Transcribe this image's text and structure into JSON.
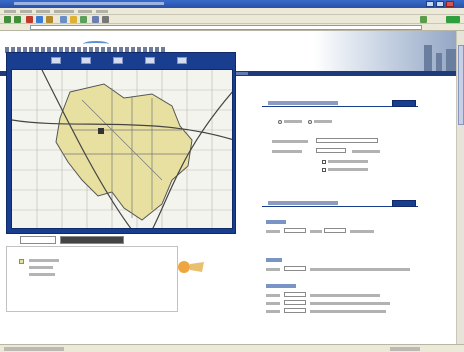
{
  "window": {
    "title": ""
  },
  "colors": {
    "titlebar": "#2851a8",
    "site_nav": "#1e3a7a",
    "map_frame": "#1a3e8f",
    "map_highlight": "#e8e0a0",
    "button_blue": "#1a3e8f",
    "go_green": "#2f9e3c"
  },
  "icons": {
    "window_controls": [
      "minimize-icon",
      "maximize-icon",
      "close-icon"
    ],
    "toolbar": [
      "back-icon",
      "forward-icon",
      "stop-icon",
      "refresh-icon",
      "home-icon",
      "search-icon",
      "favorites-icon",
      "history-icon",
      "mail-icon",
      "print-icon"
    ],
    "map_tools": [
      "zoom-in-icon",
      "zoom-out-icon",
      "pan-icon",
      "identify-icon",
      "full-extent-icon"
    ]
  },
  "search": {
    "section1_title": "",
    "section2_title": "",
    "go_label": "",
    "placeholder": ""
  },
  "statusbar": {
    "text": ""
  }
}
